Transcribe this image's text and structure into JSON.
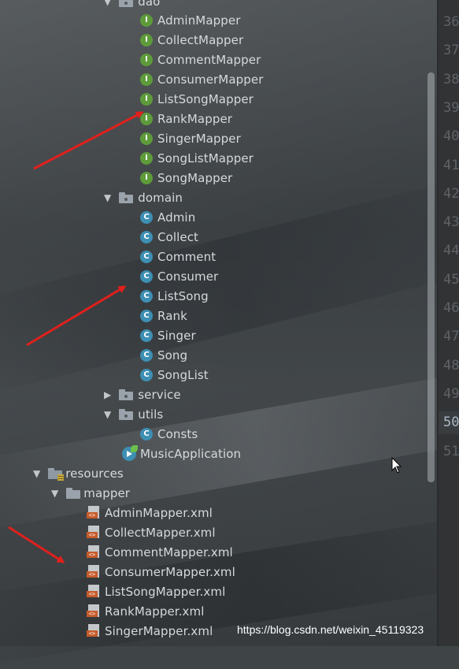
{
  "tree": {
    "dao_folder": {
      "label": "dao"
    },
    "dao_items": [
      {
        "label": "AdminMapper"
      },
      {
        "label": "CollectMapper"
      },
      {
        "label": "CommentMapper"
      },
      {
        "label": "ConsumerMapper"
      },
      {
        "label": "ListSongMapper"
      },
      {
        "label": "RankMapper"
      },
      {
        "label": "SingerMapper"
      },
      {
        "label": "SongListMapper"
      },
      {
        "label": "SongMapper"
      }
    ],
    "domain_folder": {
      "label": "domain"
    },
    "domain_items": [
      {
        "label": "Admin"
      },
      {
        "label": "Collect"
      },
      {
        "label": "Comment"
      },
      {
        "label": "Consumer"
      },
      {
        "label": "ListSong"
      },
      {
        "label": "Rank"
      },
      {
        "label": "Singer"
      },
      {
        "label": "Song"
      },
      {
        "label": "SongList"
      }
    ],
    "service_folder": {
      "label": "service"
    },
    "utils_folder": {
      "label": "utils"
    },
    "utils_items": [
      {
        "label": "Consts"
      }
    ],
    "app_class": {
      "label": "MusicApplication"
    },
    "resources_folder": {
      "label": "resources"
    },
    "mapper_folder": {
      "label": "mapper"
    },
    "mapper_items": [
      {
        "label": "AdminMapper.xml"
      },
      {
        "label": "CollectMapper.xml"
      },
      {
        "label": "CommentMapper.xml"
      },
      {
        "label": "ConsumerMapper.xml"
      },
      {
        "label": "ListSongMapper.xml"
      },
      {
        "label": "RankMapper.xml"
      },
      {
        "label": "SingerMapper.xml"
      }
    ]
  },
  "icons": {
    "interface_badge": "I",
    "class_badge": "C",
    "xml_badge": "<>"
  },
  "gutter_lines": [
    "36",
    "37",
    "38",
    "39",
    "40",
    "41",
    "42",
    "43",
    "44",
    "45",
    "46",
    "47",
    "48",
    "49",
    "50",
    "51"
  ],
  "active_line": "50",
  "watermark": "https://blog.csdn.net/weixin_45119323",
  "colors": {
    "interface_icon": "#5e9b3a",
    "class_icon": "#3d8fb3",
    "xml_icon": "#c75b2b",
    "annotation_arrow": "#e0201c"
  }
}
